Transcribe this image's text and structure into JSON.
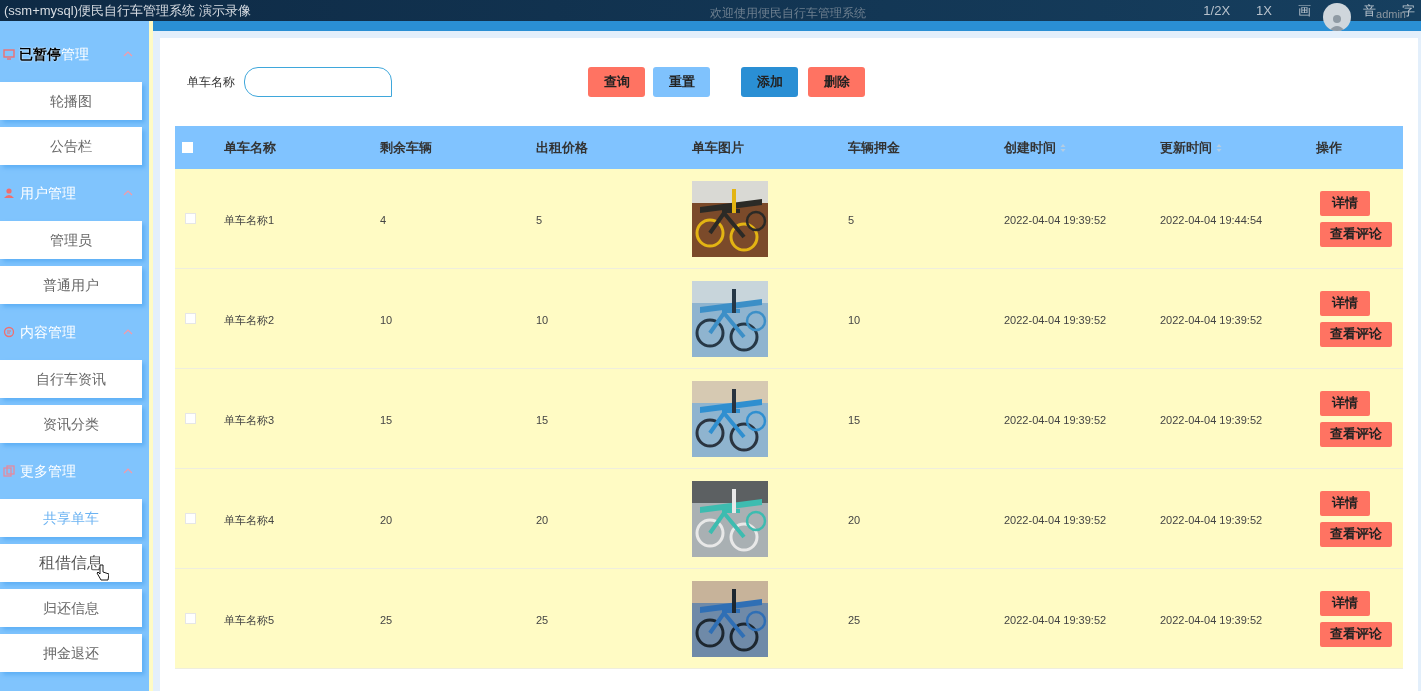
{
  "player": {
    "title": "(ssm+mysql)便民自行车管理系统 演示录像",
    "paused_label": "已暂停",
    "controls": [
      "1/2X",
      "1X",
      "画",
      "音",
      "字"
    ]
  },
  "header": {
    "welcome": "欢迎使用便民自行车管理系统",
    "user": "admin"
  },
  "sidebar": {
    "groups": [
      {
        "title": "管理",
        "expanded": true,
        "items": [
          {
            "label": "轮播图",
            "selected": false,
            "hovered": false
          },
          {
            "label": "公告栏",
            "selected": false,
            "hovered": false
          }
        ]
      },
      {
        "title": "用户管理",
        "expanded": true,
        "items": [
          {
            "label": "管理员",
            "selected": false,
            "hovered": false
          },
          {
            "label": "普通用户",
            "selected": false,
            "hovered": false
          }
        ]
      },
      {
        "title": "内容管理",
        "expanded": true,
        "items": [
          {
            "label": "自行车资讯",
            "selected": false,
            "hovered": false
          },
          {
            "label": "资讯分类",
            "selected": false,
            "hovered": false
          }
        ]
      },
      {
        "title": "更多管理",
        "expanded": true,
        "items": [
          {
            "label": "共享单车",
            "selected": true,
            "hovered": false
          },
          {
            "label": "租借信息",
            "selected": false,
            "hovered": true
          },
          {
            "label": "归还信息",
            "selected": false,
            "hovered": false
          },
          {
            "label": "押金退还",
            "selected": false,
            "hovered": false
          }
        ]
      }
    ]
  },
  "search": {
    "label": "单车名称",
    "buttons": [
      {
        "label": "查询",
        "kind": "query"
      },
      {
        "label": "重置",
        "kind": "reset"
      },
      {
        "label": "添加",
        "kind": "add"
      },
      {
        "label": "删除",
        "kind": "delete"
      }
    ]
  },
  "table": {
    "select_all": {
      "checked": false
    },
    "columns": [
      {
        "label": "单车名称"
      },
      {
        "label": "剩余车辆"
      },
      {
        "label": "出租价格"
      },
      {
        "label": "单车图片"
      },
      {
        "label": "车辆押金"
      },
      {
        "label": "创建时间",
        "sortable": true
      },
      {
        "label": "更新时间",
        "sortable": true
      },
      {
        "label": "操作"
      }
    ],
    "rows": [
      {
        "checked": false,
        "name": "单车名称1",
        "remaining": "4",
        "price": "5",
        "deposit": "5",
        "created": "2022-04-04 19:39:52",
        "updated": "2022-04-04 19:44:54",
        "actions": [
          "详情",
          "查看评论"
        ]
      },
      {
        "checked": false,
        "name": "单车名称2",
        "remaining": "10",
        "price": "10",
        "deposit": "10",
        "created": "2022-04-04 19:39:52",
        "updated": "2022-04-04 19:39:52",
        "actions": [
          "详情",
          "查看评论"
        ]
      },
      {
        "checked": false,
        "name": "单车名称3",
        "remaining": "15",
        "price": "15",
        "deposit": "15",
        "created": "2022-04-04 19:39:52",
        "updated": "2022-04-04 19:39:52",
        "actions": [
          "详情",
          "查看评论"
        ]
      },
      {
        "checked": false,
        "name": "单车名称4",
        "remaining": "20",
        "price": "20",
        "deposit": "20",
        "created": "2022-04-04 19:39:52",
        "updated": "2022-04-04 19:39:52",
        "actions": [
          "详情",
          "查看评论"
        ]
      },
      {
        "checked": false,
        "name": "单车名称5",
        "remaining": "25",
        "price": "25",
        "deposit": "25",
        "created": "2022-04-04 19:39:52",
        "updated": "2022-04-04 19:39:52",
        "actions": [
          "详情",
          "查看评论"
        ]
      }
    ]
  }
}
